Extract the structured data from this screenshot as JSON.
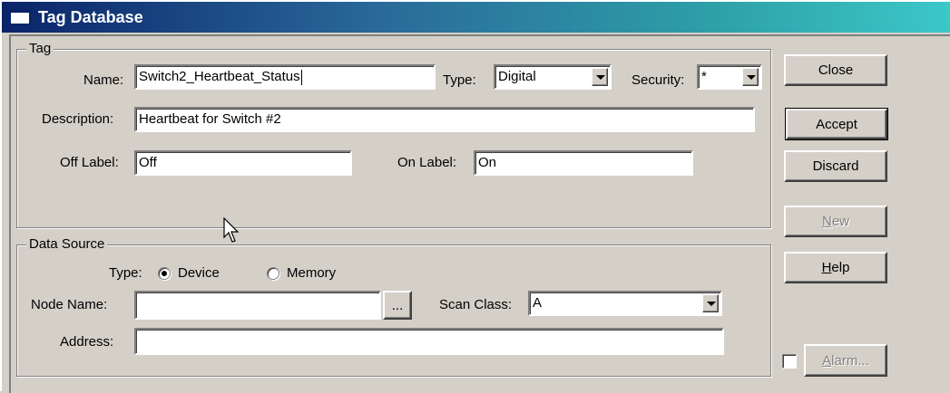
{
  "window": {
    "title": "Tag Database"
  },
  "tag_group": {
    "legend": "Tag",
    "name_label": "Name:",
    "name_value": "Switch2_Heartbeat_Status",
    "type_label": "Type:",
    "type_value": "Digital",
    "security_label": "Security:",
    "security_value": "*",
    "description_label": "Description:",
    "description_value": "Heartbeat for Switch #2",
    "off_label_label": "Off Label:",
    "off_label_value": "Off",
    "on_label_label": "On Label:",
    "on_label_value": "On"
  },
  "data_source_group": {
    "legend": "Data Source",
    "type_label": "Type:",
    "type_options": [
      "Device",
      "Memory"
    ],
    "type_selected": "Device",
    "node_name_label": "Node Name:",
    "node_name_value": "",
    "browse_label": "...",
    "scan_class_label": "Scan Class:",
    "scan_class_value": "A",
    "address_label": "Address:",
    "address_value": ""
  },
  "buttons": {
    "close": "Close",
    "accept": "Accept",
    "discard": "Discard",
    "new_mnemonic": "N",
    "new_rest": "ew",
    "help_mnemonic": "H",
    "help_rest": "elp",
    "alarm_mnemonic": "A",
    "alarm_rest": "larm..."
  },
  "alarm_checkbox": {
    "checked": false
  },
  "icons": {
    "title": "window-icon",
    "pointer": "mouse-pointer-icon"
  }
}
